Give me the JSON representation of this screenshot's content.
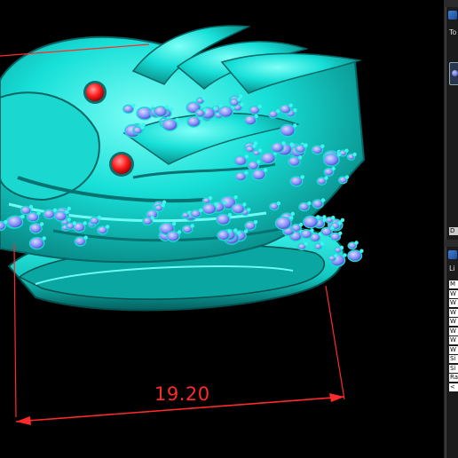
{
  "viewport": {
    "dimension_value": "19.20",
    "colors": {
      "model": "#17e0d8",
      "model_shadow": "#0a8f8f",
      "gems": "#7f86ff",
      "eyes": "#ff1a1a",
      "dimension": "#ff2a2a"
    }
  },
  "side_panel_top": {
    "header_label": "To",
    "icon": "panel-app-icon",
    "button_label": "D"
  },
  "side_panel_bottom": {
    "header_label": "Li",
    "icon": "panel-app-icon",
    "rows": [
      "M",
      "W",
      "W",
      "W",
      "W",
      "W",
      "W",
      "W",
      "Si",
      "Si",
      "Ra",
      "<"
    ]
  }
}
